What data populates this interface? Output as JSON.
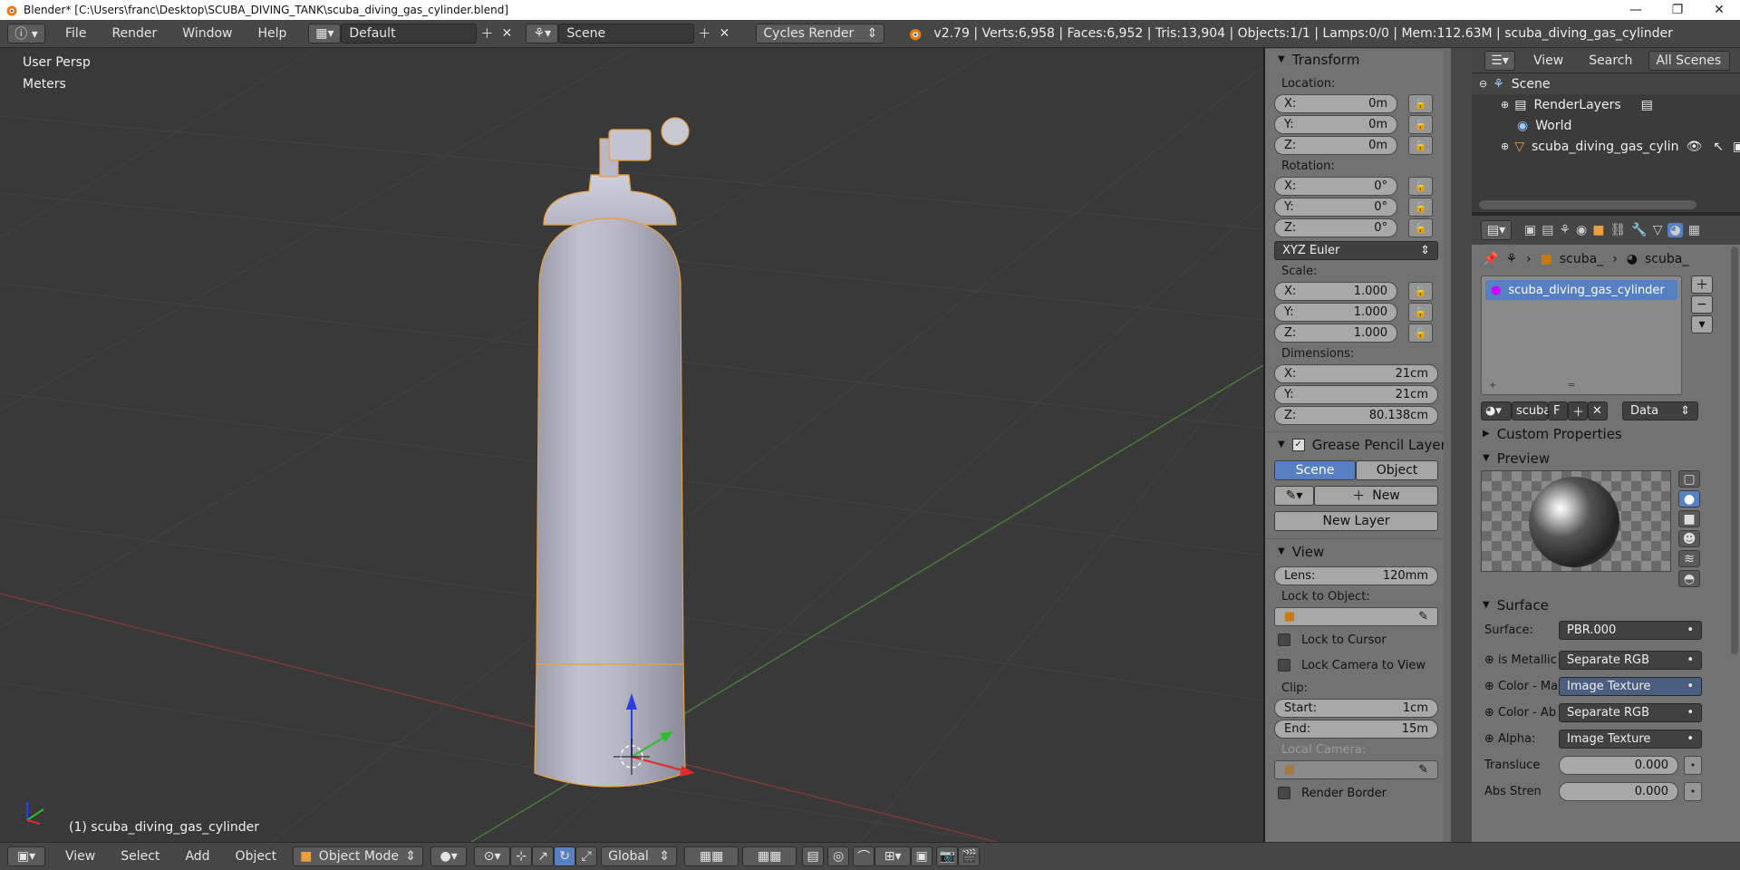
{
  "titlebar": {
    "title": "Blender* [C:\\Users\\franc\\Desktop\\SCUBA_DIVING_TANK\\scuba_diving_gas_cylinder.blend]",
    "minimize": "—",
    "maximize": "❐",
    "close": "✕"
  },
  "info": {
    "menus": [
      "File",
      "Render",
      "Window",
      "Help"
    ],
    "screen_layout": "Default",
    "scene": "Scene",
    "render_engine": "Cycles Render",
    "stats": "v2.79 | Verts:6,958 | Faces:6,952 | Tris:13,904 | Objects:1/1 | Lamps:0/0 | Mem:112.63M | scuba_diving_gas_cylinder"
  },
  "viewport": {
    "view_name": "User Persp",
    "units": "Meters",
    "object_label": "(1) scuba_diving_gas_cylinder"
  },
  "transform": {
    "title": "Transform",
    "location_label": "Location:",
    "location": [
      {
        "axis": "X:",
        "value": "0m"
      },
      {
        "axis": "Y:",
        "value": "0m"
      },
      {
        "axis": "Z:",
        "value": "0m"
      }
    ],
    "rotation_label": "Rotation:",
    "rotation": [
      {
        "axis": "X:",
        "value": "0°"
      },
      {
        "axis": "Y:",
        "value": "0°"
      },
      {
        "axis": "Z:",
        "value": "0°"
      }
    ],
    "rotation_mode": "XYZ Euler",
    "scale_label": "Scale:",
    "scale": [
      {
        "axis": "X:",
        "value": "1.000"
      },
      {
        "axis": "Y:",
        "value": "1.000"
      },
      {
        "axis": "Z:",
        "value": "1.000"
      }
    ],
    "dimensions_label": "Dimensions:",
    "dimensions": [
      {
        "axis": "X:",
        "value": "21cm"
      },
      {
        "axis": "Y:",
        "value": "21cm"
      },
      {
        "axis": "Z:",
        "value": "80.138cm"
      }
    ]
  },
  "grease_pencil": {
    "title": "Grease Pencil Layer",
    "tab_scene": "Scene",
    "tab_object": "Object",
    "new_label": "New",
    "new_layer_label": "New Layer"
  },
  "view_panel": {
    "title": "View",
    "lens_label": "Lens:",
    "lens_value": "120mm",
    "lock_to_object": "Lock to Object:",
    "lock_to_cursor": "Lock to Cursor",
    "lock_camera": "Lock Camera to View",
    "clip_label": "Clip:",
    "clip_start_label": "Start:",
    "clip_start": "1cm",
    "clip_end_label": "End:",
    "clip_end": "15m",
    "local_camera": "Local Camera:",
    "render_border": "Render Border"
  },
  "outliner": {
    "view": "View",
    "search": "Search",
    "filter": "All Scenes",
    "items": [
      "Scene",
      "RenderLayers",
      "World",
      "scuba_diving_gas_cylin"
    ]
  },
  "properties": {
    "breadcrumb_1": "scuba_",
    "breadcrumb_2": "scuba_",
    "material_slot": "scuba_diving_gas_cylinder",
    "material_name": "scuba",
    "fake_user": "F",
    "link": "Data",
    "custom_properties": "Custom Properties",
    "preview": "Preview",
    "surface_header": "Surface",
    "surface_label": "Surface:",
    "surface_value": "PBR.000",
    "inputs": [
      {
        "label": "is Metallic",
        "value": "Separate RGB"
      },
      {
        "label": "Color - Ma",
        "value": "Image Texture"
      },
      {
        "label": "Color - Ab",
        "value": "Separate RGB"
      },
      {
        "label": "Alpha:",
        "value": "Image Texture"
      }
    ],
    "translucency_label": "Transluce",
    "translucency": "0.000",
    "abs_strength_label": "Abs Stren",
    "abs_strength": "0.000"
  },
  "footer": {
    "menus": [
      "View",
      "Select",
      "Add",
      "Object"
    ],
    "mode": "Object Mode",
    "orientation": "Global"
  },
  "colors": {
    "selection_outline": "#e8a040",
    "panel_bg": "#727272",
    "viewport_bg": "#393939",
    "active_tab": "#5680c2"
  }
}
